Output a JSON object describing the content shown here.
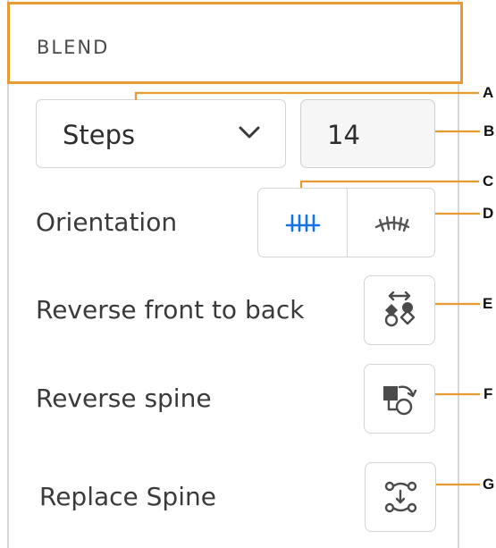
{
  "panel": {
    "title": "BLEND",
    "method": {
      "selected": "Steps"
    },
    "steps": {
      "value": "14"
    },
    "orientation": {
      "label": "Orientation",
      "options": [
        "align-to-page",
        "align-to-path"
      ],
      "selected": "align-to-page"
    },
    "reverse_front_to_back": {
      "label": "Reverse front to back",
      "icon": "reverse-front-to-back-icon"
    },
    "reverse_spine": {
      "label": "Reverse spine",
      "icon": "reverse-spine-icon"
    },
    "replace_spine": {
      "label": "Replace Spine",
      "icon": "replace-spine-icon"
    }
  },
  "callouts": [
    "A",
    "B",
    "C",
    "D",
    "E",
    "F",
    "G"
  ],
  "colors": {
    "accent_orange": "#e89b2e",
    "selected_blue": "#1473e6",
    "icon_gray": "#4b4b4b",
    "border": "#d4d4d4"
  }
}
